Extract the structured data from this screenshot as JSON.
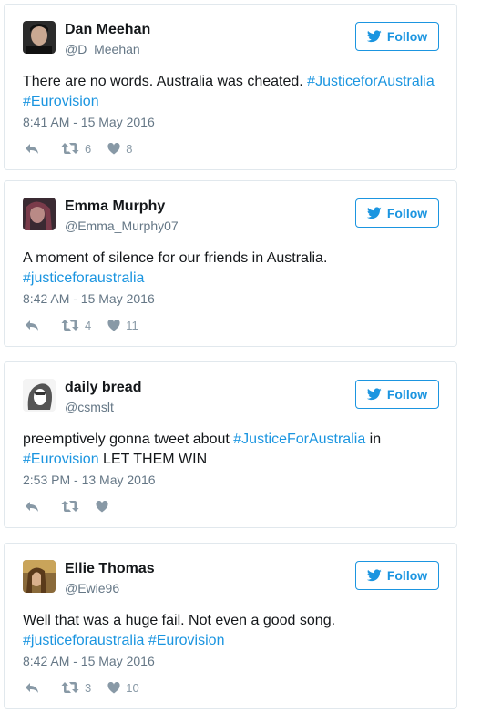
{
  "follow_label": "Follow",
  "colors": {
    "link": "#1b95e0",
    "muted": "#657786",
    "icon": "#8899a6",
    "border": "#e1e8ed"
  },
  "icons": {
    "follow": "twitter-bird-icon",
    "reply": "reply-icon",
    "retweet": "retweet-icon",
    "like": "heart-icon"
  },
  "tweets": [
    {
      "name": "Dan Meehan",
      "handle": "@D_Meehan",
      "segments": [
        {
          "text": "There are no words. Australia was cheated. ",
          "tag": false
        },
        {
          "text": "#JusticeforAustralia",
          "tag": true
        },
        {
          "text": " ",
          "tag": false
        },
        {
          "text": "#Eurovision",
          "tag": true
        }
      ],
      "timestamp": "8:41 AM - 15 May 2016",
      "retweets": "6",
      "likes": "8"
    },
    {
      "name": "Emma Murphy",
      "handle": "@Emma_Murphy07",
      "segments": [
        {
          "text": "A moment of silence for our friends in Australia. ",
          "tag": false
        },
        {
          "text": "#justiceforaustralia",
          "tag": true
        }
      ],
      "timestamp": "8:42 AM - 15 May 2016",
      "retweets": "4",
      "likes": "11"
    },
    {
      "name": "daily bread",
      "handle": "@csmslt",
      "segments": [
        {
          "text": "preemptively gonna tweet about ",
          "tag": false
        },
        {
          "text": "#JusticeForAustralia",
          "tag": true
        },
        {
          "text": " in ",
          "tag": false
        },
        {
          "text": "#Eurovision",
          "tag": true
        },
        {
          "text": " LET THEM WIN",
          "tag": false
        }
      ],
      "timestamp": "2:53 PM - 13 May 2016",
      "retweets": "",
      "likes": ""
    },
    {
      "name": "Ellie Thomas",
      "handle": "@Ewie96",
      "segments": [
        {
          "text": "Well that was a huge fail. Not even a good song. ",
          "tag": false
        },
        {
          "text": "#justiceforaustralia",
          "tag": true
        },
        {
          "text": " ",
          "tag": false
        },
        {
          "text": "#Eurovision",
          "tag": true
        }
      ],
      "timestamp": "8:42 AM - 15 May 2016",
      "retweets": "3",
      "likes": "10"
    }
  ]
}
